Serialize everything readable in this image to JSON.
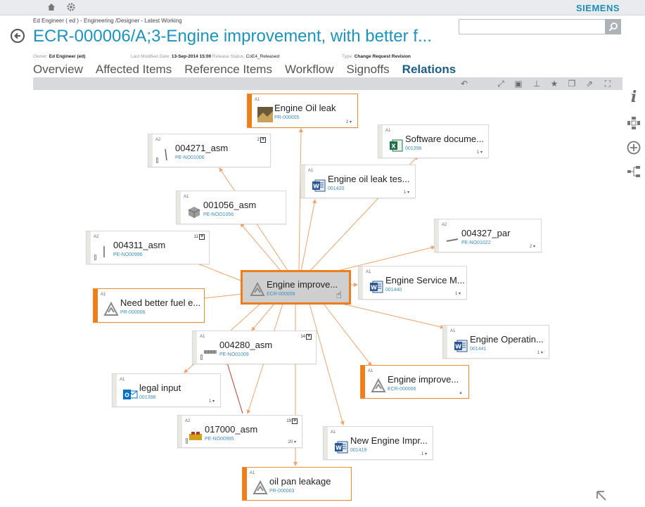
{
  "header": {
    "brand": "SIEMENS",
    "breadcrumb": "Ed Engineer ( ed ) - Engineering /Designer - Latest Working",
    "title": "ECR-000006/A;3-Engine improvement, with better f...",
    "search": {
      "value": "",
      "placeholder": ""
    }
  },
  "meta": {
    "owner_label": "Owner:",
    "owner_value": "Ed Engineer (ed)",
    "modified_label": "Last Modified Date:",
    "modified_value": "13-Sep-2014 15:00",
    "status_label": "Release Status:",
    "status_value": "CoE4_Released",
    "type_label": "Type:",
    "type_value": "Change Request Revision"
  },
  "tabs": [
    {
      "label": "Overview"
    },
    {
      "label": "Affected Items"
    },
    {
      "label": "Reference Items"
    },
    {
      "label": "Workflow"
    },
    {
      "label": "Signoffs"
    },
    {
      "label": "Relations",
      "active": true
    }
  ],
  "toolbar_icons": [
    "undo-icon",
    "expand-icon",
    "layout-icon",
    "pin-icon",
    "favorite-icon",
    "copy-icon",
    "share-icon",
    "fullscreen-icon"
  ],
  "side_tools": [
    "info-icon",
    "navigate-icon",
    "add-icon",
    "tree-icon"
  ],
  "colors": {
    "accent": "#1b93c0",
    "selected_border": "#ef7d1a",
    "edge_orange": "#f2a36a",
    "edge_red": "#c0392b"
  },
  "nodes": {
    "oil_leak": {
      "rev": "A1",
      "title": "Engine Oil leak",
      "id": "PR-000005",
      "count": "2"
    },
    "asm_004271": {
      "rev": "A2",
      "title": "004271_asm",
      "id": "PE-NO01006",
      "expand": "2"
    },
    "software_doc": {
      "rev": "A1",
      "title": "Software docume...",
      "id": "001396",
      "count": "1"
    },
    "oil_leak_test": {
      "rev": "A1",
      "title": "Engine oil leak tes...",
      "id": "001420",
      "count": "1"
    },
    "asm_001056": {
      "rev": "A1",
      "title": "001056_asm",
      "id": "PE-NOO1056"
    },
    "par_004327": {
      "rev": "A2",
      "title": "004327_par",
      "id": "PE-NO01022",
      "count": "2"
    },
    "asm_004311": {
      "rev": "A2",
      "title": "004311_asm",
      "id": "PE-NO00996",
      "expand": "11"
    },
    "center": {
      "title": "Engine improve...",
      "id": "ECR-000006"
    },
    "service_manual": {
      "rev": "A1",
      "title": "Engine Service M...",
      "id": "001440",
      "count": "1"
    },
    "fuel": {
      "rev": "A1",
      "title": "Need better fuel e...",
      "id": "PR-000006"
    },
    "asm_004280": {
      "rev": "A1",
      "title": "004280_asm",
      "id": "PE-NO01009",
      "expand": "14"
    },
    "operating": {
      "rev": "A1",
      "title": "Engine Operatin...",
      "id": "001441",
      "count": "1"
    },
    "legal": {
      "rev": "A1",
      "title": "legal input",
      "id": "001398",
      "count": "1"
    },
    "engine_improve_2": {
      "rev": "A1",
      "title": "Engine improve...",
      "id": "ECR-000006"
    },
    "asm_017000": {
      "rev": "A2",
      "title": "017000_asm",
      "id": "PE-NO00995",
      "expand": "19",
      "count": "20"
    },
    "new_engine": {
      "rev": "A1",
      "title": "New Engine Impr...",
      "id": "001419",
      "count": "1"
    },
    "oil_pan": {
      "rev": "A1",
      "title": "oil pan leakage",
      "id": "PR-000003"
    }
  }
}
